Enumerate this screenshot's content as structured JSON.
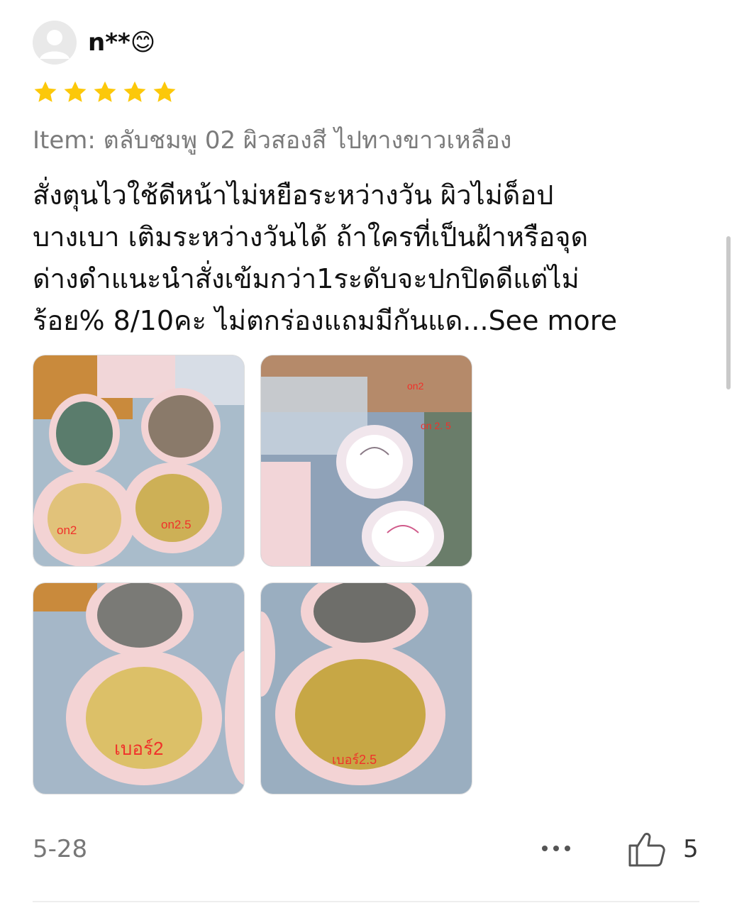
{
  "review": {
    "username": "n**",
    "username_emoji": "😊",
    "rating": 5,
    "item_label": "Item: ตลับชมพู 02 ผิวสองสี ไปทางขาวเหลือง",
    "text_lines": [
      "สั่งตุนไวใช้ดีหน้าไม่หยือระหว่างวัน ผิวไม่ด็อป",
      "บางเบา เติมระหว่างวันได้ ถ้าใครที่เป็นฝ้าหรือจุด",
      "ด่างดำแนะนำสั่งเข้มกว่า1ระดับจะปกปิดดีแต่ไม่",
      "ร้อย% 8/10คะ ไม่ตกร่องแถมมีกันแด..."
    ],
    "see_more": "See more",
    "photos": [
      {
        "labels": [
          "on2",
          "on2.5"
        ]
      },
      {
        "labels": [
          "on2",
          "on 2. 5"
        ]
      },
      {
        "labels": [
          "เบอร์2"
        ]
      },
      {
        "labels": [
          "เบอร์2.5"
        ]
      }
    ],
    "date": "5-28",
    "like_count": "5"
  },
  "icons": {
    "avatar": "default-user-avatar",
    "star": "star-icon",
    "more": "more-dots-icon",
    "like": "thumbs-up-icon"
  },
  "colors": {
    "star": "#FCC80A",
    "photo_label": "#F0312A",
    "muted_text": "#7B7B7B"
  }
}
